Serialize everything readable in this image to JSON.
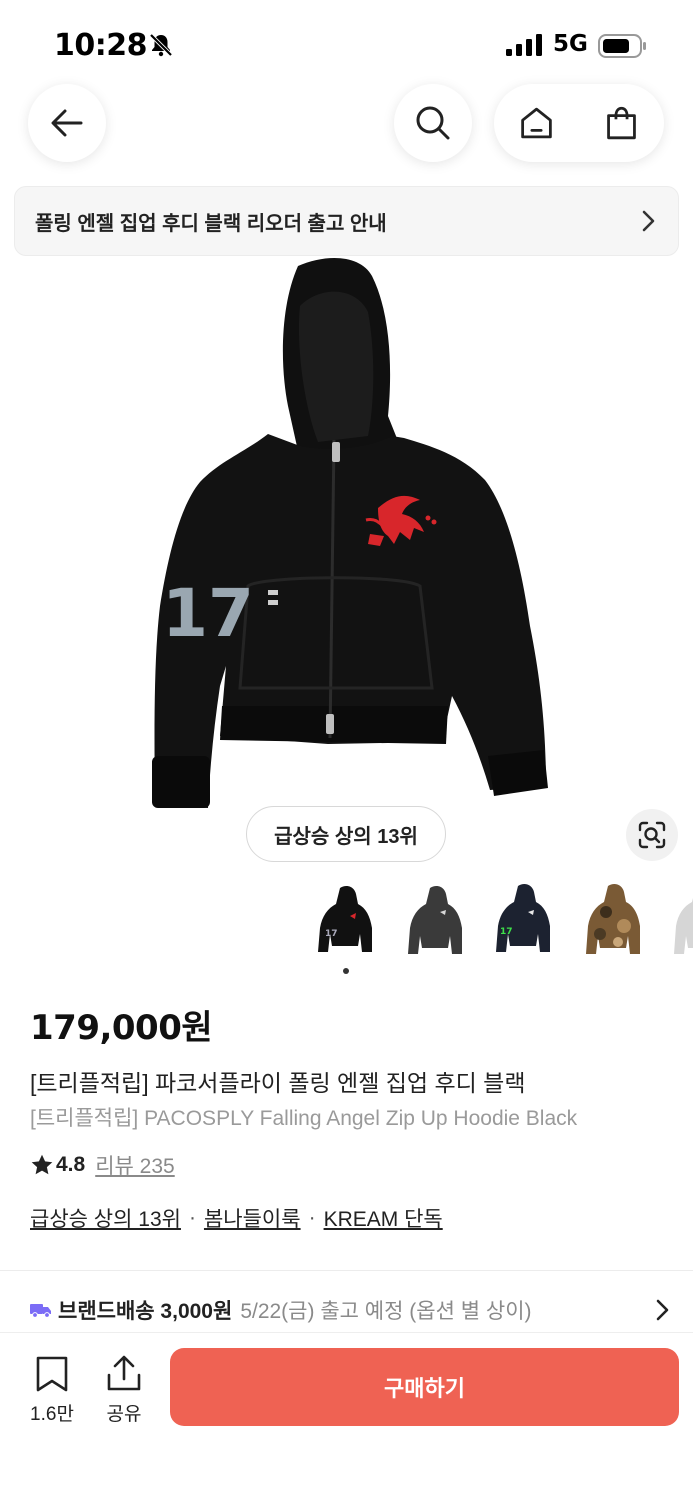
{
  "status_bar": {
    "time": "10:28",
    "network": "5G"
  },
  "nav": {
    "icons": [
      "back-arrow-icon",
      "search-icon",
      "home-icon",
      "shopping-bag-icon"
    ]
  },
  "notice": {
    "text": "폴링 엔젤 집업 후디 블랙 리오더 출고 안내"
  },
  "hero": {
    "rank_badge": "급상승 상의 13위",
    "sleeve_number": "17"
  },
  "thumbnails": {
    "selected_index": 0,
    "count": 5
  },
  "product": {
    "price": "179,000원",
    "name_ko": "[트리플적립] 파코서플라이 폴링 엔젤 집업 후디 블랙",
    "name_en": "[트리플적립] PACOSPLY Falling Angel Zip Up Hoodie Black",
    "rating": "4.8",
    "reviews": "리뷰 235",
    "tags": [
      "급상승 상의 13위",
      "봄나들이룩",
      "KREAM 단독"
    ],
    "tag_separator": "·"
  },
  "shipping": {
    "label": "브랜드배송 3,000원",
    "eta": "5/22(금) 출고 예정 (옵션 별 상이)"
  },
  "bottom_bar": {
    "save_count": "1.6만",
    "share_label": "공유",
    "buy_label": "구매하기"
  },
  "colors": {
    "buy_button": "#ef6253",
    "truck_icon": "#7b6cf6",
    "emblem_red": "#d8262b"
  }
}
